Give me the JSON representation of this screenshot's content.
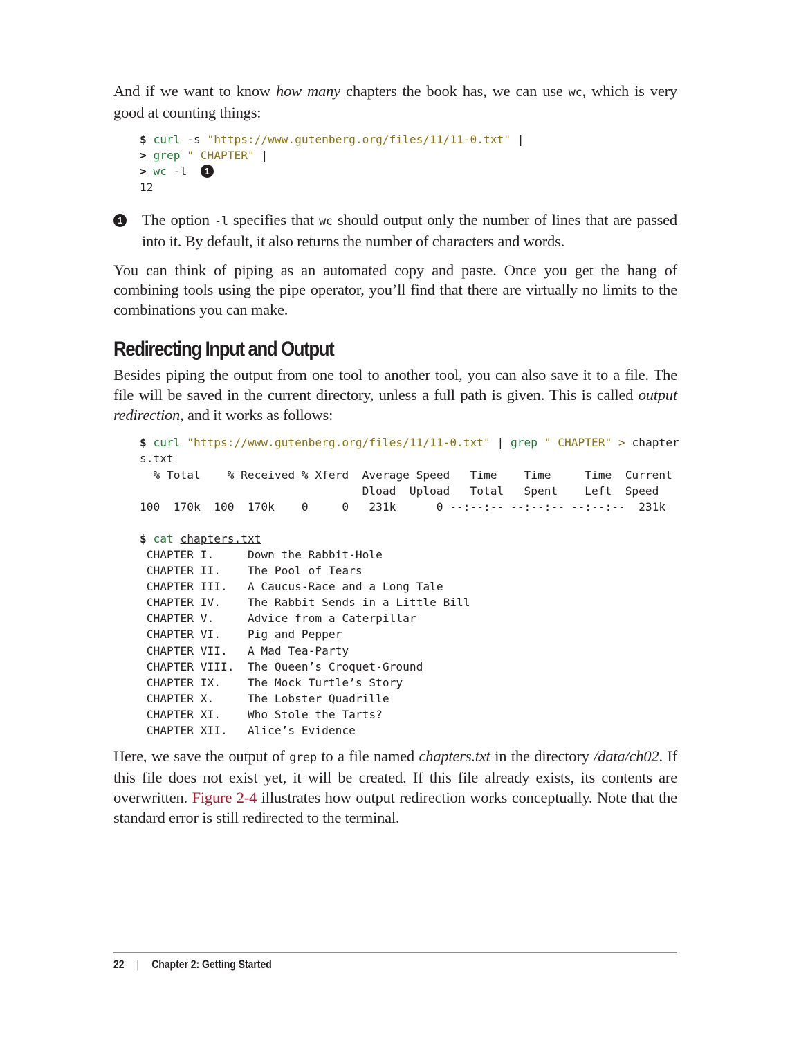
{
  "intro": {
    "part1": "And if we want to know ",
    "emph": "how many",
    "part2": " chapters the book has, we can use ",
    "code": "wc",
    "part3": ", which is very good at counting things:"
  },
  "code_block_1": {
    "lines": [
      {
        "prompt": "$",
        "cmd": "curl",
        "args": " -s ",
        "str": "\"https://www.gutenberg.org/files/11/11-0.txt\"",
        "tail": " |"
      },
      {
        "prompt": ">",
        "cmd": "grep",
        "args": " ",
        "str": "\" CHAPTER\"",
        "tail": " |"
      },
      {
        "prompt": ">",
        "cmd": "wc",
        "args": " -l",
        "callout": "1"
      }
    ],
    "output": "12"
  },
  "callout_1": {
    "marker": "1",
    "text_before": "The option ",
    "code1": "-l",
    "text_mid": " specifies that ",
    "code2": "wc",
    "text_after": " should output only the number of lines that are passed into it. By default, it also returns the number of characters and words."
  },
  "para_piping": "You can think of piping as an automated copy and paste. Once you get the hang of combining tools using the pipe operator, you’ll find that there are virtually no limits to the combinations you can make.",
  "section": {
    "heading": "Redirecting Input and Output",
    "para1_text": "Besides piping the output from one tool to another tool, you can also save it to a file. The file will be saved in the current directory, unless a full path is given. This is called ",
    "para1_emph": "output redirection",
    "para1_tail": ", and it works as follows:"
  },
  "code_block_2": {
    "prompt": "$",
    "cmd1": "curl",
    "str1": "\"https://www.gutenberg.org/files/11/11-0.txt\"",
    "pipe": " | ",
    "cmd2": "grep",
    "str2": "\" CHAPTER\"",
    "redirect": " > ",
    "target_part1": "chapter",
    "target_part2": "s.txt",
    "progress_header1": "  % Total    % Received % Xferd  Average Speed   Time    Time     Time  Current",
    "progress_header2": "                                 Dload  Upload   Total   Spent    Left  Speed",
    "progress_values": "100  170k  100  170k    0     0   231k      0 --:--:-- --:--:-- --:--:--  231k",
    "prompt2": "$",
    "cmd3": "cat",
    "file": "chapters.txt",
    "chapters": [
      {
        "num": "CHAPTER I.",
        "title": "Down the Rabbit-Hole"
      },
      {
        "num": "CHAPTER II.",
        "title": "The Pool of Tears"
      },
      {
        "num": "CHAPTER III.",
        "title": "A Caucus-Race and a Long Tale"
      },
      {
        "num": "CHAPTER IV.",
        "title": "The Rabbit Sends in a Little Bill"
      },
      {
        "num": "CHAPTER V.",
        "title": "Advice from a Caterpillar"
      },
      {
        "num": "CHAPTER VI.",
        "title": "Pig and Pepper"
      },
      {
        "num": "CHAPTER VII.",
        "title": "A Mad Tea-Party"
      },
      {
        "num": "CHAPTER VIII.",
        "title": "The Queen’s Croquet-Ground"
      },
      {
        "num": "CHAPTER IX.",
        "title": "The Mock Turtle’s Story"
      },
      {
        "num": "CHAPTER X.",
        "title": "The Lobster Quadrille"
      },
      {
        "num": "CHAPTER XI.",
        "title": "Who Stole the Tarts?"
      },
      {
        "num": "CHAPTER XII.",
        "title": "Alice’s Evidence"
      }
    ]
  },
  "para_here": {
    "t1": "Here, we save the output of ",
    "code": "grep",
    "t2": " to a file named ",
    "em1": "chapters.txt",
    "t3": " in the directory ",
    "em2": "/data/ch02",
    "t4": ". If this file does not exist yet, it will be created. If this file already exists, its contents are overwritten. ",
    "link": "Figure 2-4",
    "t5": " illustrates how output redirection works conceptually. Note that the standard error is still redirected to the terminal."
  },
  "colors": {
    "command": "#1e7a32",
    "string": "#8a7218",
    "xref": "#a5192b"
  },
  "footer": {
    "page_number": "22",
    "separator": "|",
    "chapter": "Chapter 2: Getting Started"
  }
}
